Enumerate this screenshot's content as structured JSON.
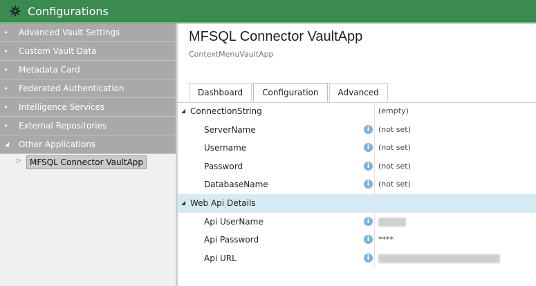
{
  "window": {
    "title": "Configurations",
    "icon": "gear-icon"
  },
  "sidebar": {
    "items": [
      {
        "label": "Advanced Vault Settings"
      },
      {
        "label": "Custom Vault Data"
      },
      {
        "label": "Metadata Card"
      },
      {
        "label": "Federated Authentication"
      },
      {
        "label": "Intelligence Services"
      },
      {
        "label": "External Repositories"
      },
      {
        "label": "Other Applications"
      }
    ],
    "selected_child": "MFSQL Connector VaultApp"
  },
  "main": {
    "title": "MFSQL Connector VaultApp",
    "subtitle": "ContextMenuVaultApp",
    "tabs": [
      {
        "label": "Dashboard"
      },
      {
        "label": "Configuration"
      },
      {
        "label": "Advanced"
      }
    ],
    "active_tab": "Configuration",
    "groups": [
      {
        "label": "ConnectionString",
        "value": "(empty)",
        "fields": [
          {
            "label": "ServerName",
            "value": "(not set)"
          },
          {
            "label": "Username",
            "value": "(not set)"
          },
          {
            "label": "Password",
            "value": "(not set)"
          },
          {
            "label": "DatabaseName",
            "value": "(not set)"
          }
        ]
      },
      {
        "label": "Web Api Details",
        "value": "",
        "fields": [
          {
            "label": "Api UserName",
            "value": ""
          },
          {
            "label": "Api Password",
            "value": "****"
          },
          {
            "label": "Api URL",
            "value": ""
          }
        ]
      }
    ]
  },
  "colors": {
    "titlebar": "#3b8a4f",
    "nav_item_bg": "#a9a9a9",
    "selected_row": "#d6eaf3",
    "info_icon": "#7fb3d5"
  }
}
